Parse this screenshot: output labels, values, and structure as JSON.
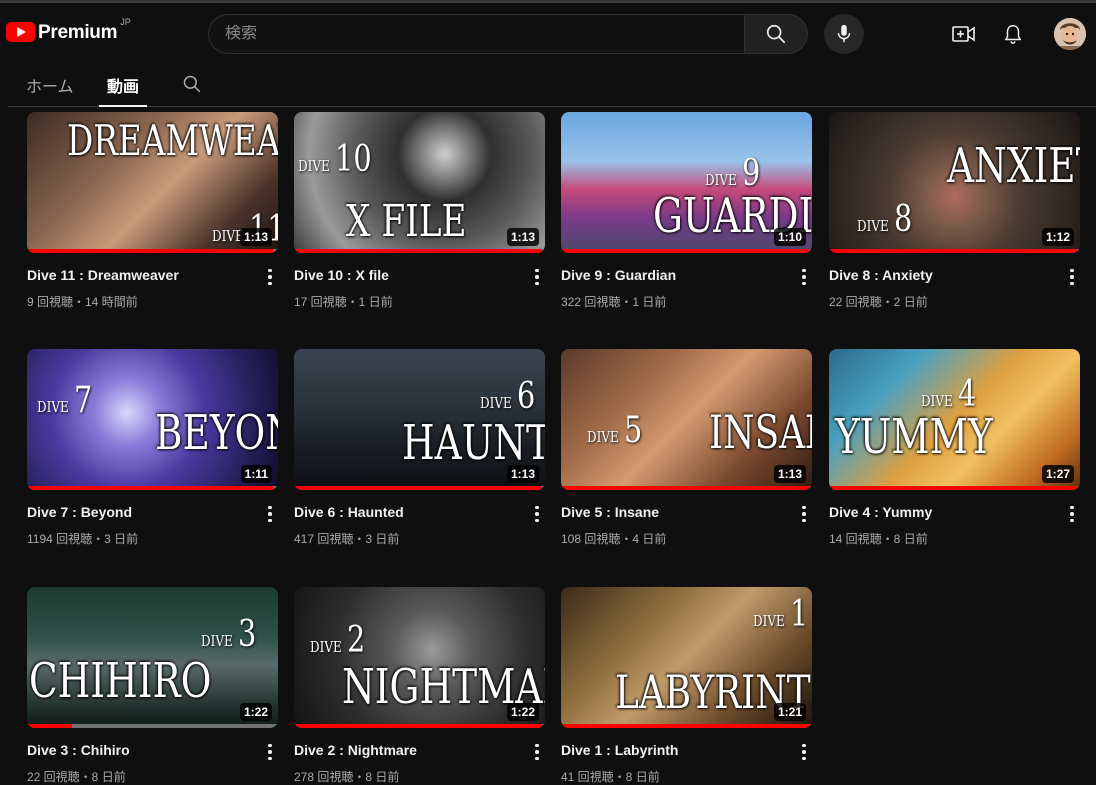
{
  "header": {
    "logo_text": "Premium",
    "logo_region": "JP",
    "search_placeholder": "検索"
  },
  "tabs": [
    {
      "label": "ホーム",
      "active": false
    },
    {
      "label": "動画",
      "active": true
    }
  ],
  "colors": {
    "accent": "#ff0000",
    "background": "#0f0f0f"
  },
  "videos": [
    {
      "title": "Dive 11 : Dreamweaver",
      "meta": "9 回視聴・14 時間前",
      "duration": "1:13",
      "thumb_title": "DREAMWEAVER",
      "dive_number": "11",
      "progress": 0.98
    },
    {
      "title": "Dive 10 : X file",
      "meta": "17 回視聴・1 日前",
      "duration": "1:13",
      "thumb_title": "X FILE",
      "dive_number": "10",
      "progress": 0.99
    },
    {
      "title": "Dive 9 : Guardian",
      "meta": "322 回視聴・1 日前",
      "duration": "1:10",
      "thumb_title": "GUARDIAN",
      "dive_number": "9",
      "progress": 0.99
    },
    {
      "title": "Dive 8 : Anxiety",
      "meta": "22 回視聴・2 日前",
      "duration": "1:12",
      "thumb_title": "ANXIETY",
      "dive_number": "8",
      "progress": 0.99
    },
    {
      "title": "Dive 7 : Beyond",
      "meta": "1194 回視聴・3 日前",
      "duration": "1:11",
      "thumb_title": "BEYOND",
      "dive_number": "7",
      "progress": 0.98
    },
    {
      "title": "Dive 6 : Haunted",
      "meta": "417 回視聴・3 日前",
      "duration": "1:13",
      "thumb_title": "HAUNTED",
      "dive_number": "6",
      "progress": 0.99
    },
    {
      "title": "Dive 5 : Insane",
      "meta": "108 回視聴・4 日前",
      "duration": "1:13",
      "thumb_title": "INSANE",
      "dive_number": "5",
      "progress": 0.99
    },
    {
      "title": "Dive 4 : Yummy",
      "meta": "14 回視聴・8 日前",
      "duration": "1:27",
      "thumb_title": "YUMMY",
      "dive_number": "4",
      "progress": 0.99
    },
    {
      "title": "Dive 3 : Chihiro",
      "meta": "22 回視聴・8 日前",
      "duration": "1:22",
      "thumb_title": "CHIHIRO",
      "dive_number": "3",
      "progress": 0.18
    },
    {
      "title": "Dive 2 : Nightmare",
      "meta": "278 回視聴・8 日前",
      "duration": "1:22",
      "thumb_title": "NIGHTMARE",
      "dive_number": "2",
      "progress": 0.99
    },
    {
      "title": "Dive 1 : Labyrinth",
      "meta": "41 回視聴・8 日前",
      "duration": "1:21",
      "thumb_title": "LABYRINTH",
      "dive_number": "1",
      "progress": 0.99
    }
  ]
}
